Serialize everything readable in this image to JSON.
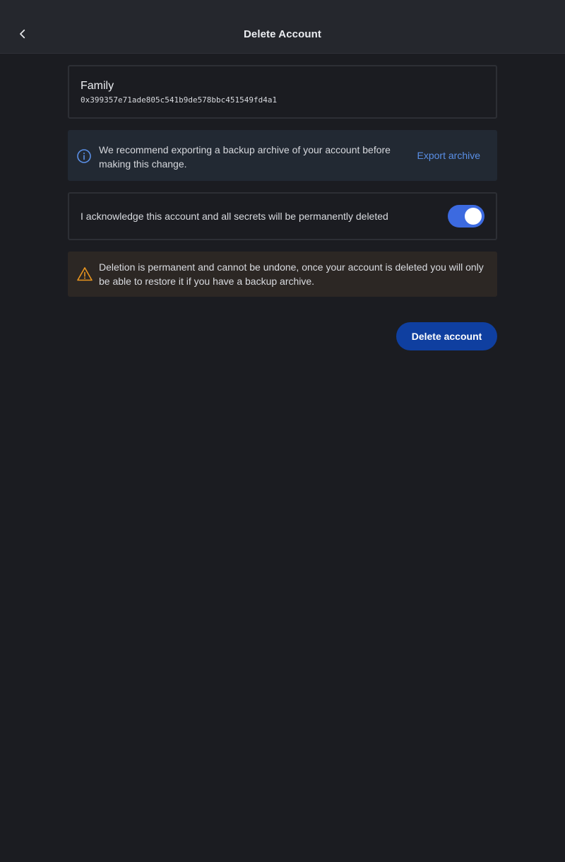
{
  "header": {
    "title": "Delete Account",
    "back_icon": "chevron-left-icon"
  },
  "account": {
    "name": "Family",
    "address": "0x399357e71ade805c541b9de578bbc451549fd4a1"
  },
  "info_banner": {
    "icon": "info-icon",
    "text": "We recommend exporting a backup archive of your account before making this change.",
    "action_label": "Export archive",
    "accent_color": "#5a8fe6"
  },
  "acknowledge": {
    "label": "I acknowledge this account and all secrets will be permanently deleted",
    "checked": true,
    "toggle_color": "#3c6ae0"
  },
  "warning_banner": {
    "icon": "warning-icon",
    "text": "Deletion is permanent and cannot be undone, once your account is deleted you will only be able to restore it if you have a backup archive.",
    "accent_color": "#e8951f"
  },
  "actions": {
    "delete_label": "Delete account",
    "delete_color": "#0f3fa0"
  }
}
